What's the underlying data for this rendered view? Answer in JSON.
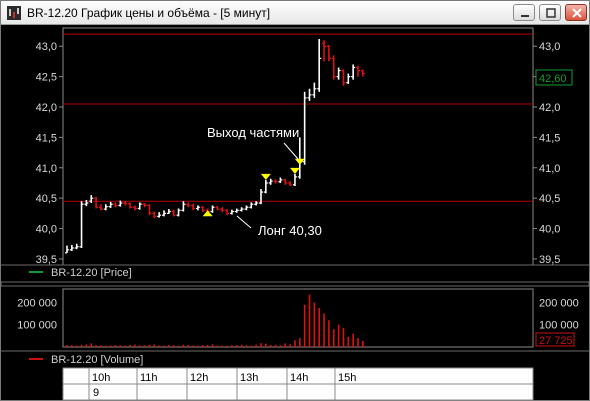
{
  "window": {
    "title": "BR-12.20 График цены и объёма - [5 минут]"
  },
  "price_panel": {
    "legend": "BR-12.20 [Price]",
    "legend_color": "#0f9d2d",
    "last_price_label": "42,60",
    "annotations": [
      {
        "text": "Выход частями"
      },
      {
        "text": "Лонг 40,30"
      }
    ],
    "yticks": [
      "43,0",
      "42,5",
      "42,0",
      "41,5",
      "41,0",
      "40,5",
      "40,0",
      "39,5"
    ]
  },
  "volume_panel": {
    "legend": "BR-12.20 [Volume]",
    "legend_color": "#cc1010",
    "last_volume_label": "27 725",
    "yticks": [
      "200 000",
      "100 000",
      "0"
    ]
  },
  "time_axis": {
    "hours": [
      "10h",
      "11h",
      "12h",
      "13h",
      "14h",
      "15h"
    ],
    "date": "9"
  },
  "colors": {
    "background": "#000000",
    "up_bar": "#ffffff",
    "down_bar": "#e01010",
    "level_line": "#b00000",
    "marker": "#ffff00"
  },
  "chart_data": [
    {
      "type": "line",
      "title": "BR-12.20 [Price]",
      "ylim": [
        39.4,
        43.3
      ],
      "horizontal_levels": [
        43.2,
        42.05,
        40.45
      ],
      "series": [
        {
          "name": "BR-12.20 [Price]",
          "close": [
            39.65,
            39.68,
            39.7,
            40.4,
            40.42,
            40.5,
            40.35,
            40.32,
            40.36,
            40.4,
            40.38,
            40.42,
            40.41,
            40.35,
            40.33,
            40.4,
            40.38,
            40.25,
            40.2,
            40.22,
            40.25,
            40.28,
            40.22,
            40.3,
            40.4,
            40.38,
            40.33,
            40.35,
            40.3,
            40.28,
            40.35,
            40.32,
            40.3,
            40.25,
            40.28,
            40.3,
            40.32,
            40.35,
            40.4,
            40.42,
            40.6,
            40.75,
            40.78,
            40.77,
            40.8,
            40.75,
            40.72,
            40.85,
            41.1,
            42.15,
            42.2,
            42.3,
            42.8,
            43.0,
            42.8,
            42.5,
            42.6,
            42.4,
            42.5,
            42.65,
            42.6,
            42.55
          ],
          "open": [
            39.6,
            39.65,
            39.68,
            39.7,
            40.4,
            40.45,
            40.5,
            40.35,
            40.32,
            40.36,
            40.4,
            40.38,
            40.42,
            40.41,
            40.35,
            40.33,
            40.4,
            40.38,
            40.25,
            40.2,
            40.22,
            40.25,
            40.28,
            40.22,
            40.3,
            40.4,
            40.38,
            40.33,
            40.35,
            40.3,
            40.28,
            40.35,
            40.32,
            40.3,
            40.25,
            40.28,
            40.3,
            40.32,
            40.35,
            40.4,
            40.42,
            40.6,
            40.75,
            40.78,
            40.77,
            40.8,
            40.75,
            40.72,
            40.85,
            41.1,
            42.15,
            42.2,
            42.3,
            43.05,
            43.0,
            42.8,
            42.5,
            42.6,
            42.4,
            42.5,
            42.65,
            42.6
          ],
          "high": [
            39.72,
            39.73,
            39.75,
            40.45,
            40.47,
            40.55,
            40.52,
            40.4,
            40.4,
            40.44,
            40.43,
            40.46,
            40.45,
            40.43,
            40.38,
            40.43,
            40.42,
            40.4,
            40.28,
            40.27,
            40.3,
            40.32,
            40.31,
            40.33,
            40.45,
            40.43,
            40.41,
            40.38,
            40.37,
            40.33,
            40.38,
            40.37,
            40.35,
            40.32,
            40.31,
            40.33,
            40.35,
            40.38,
            40.43,
            40.45,
            40.65,
            40.8,
            40.82,
            40.81,
            40.84,
            40.82,
            40.78,
            40.9,
            41.5,
            42.25,
            42.3,
            42.4,
            43.12,
            43.1,
            43.02,
            42.85,
            42.65,
            42.62,
            42.55,
            42.7,
            42.68,
            42.62
          ],
          "low": [
            39.6,
            39.63,
            39.66,
            39.68,
            40.37,
            40.42,
            40.33,
            40.3,
            40.3,
            40.34,
            40.35,
            40.36,
            40.38,
            40.33,
            40.3,
            40.31,
            40.35,
            40.22,
            40.17,
            40.18,
            40.2,
            40.24,
            40.2,
            40.2,
            40.28,
            40.35,
            40.3,
            40.3,
            40.27,
            40.26,
            40.26,
            40.3,
            40.27,
            40.22,
            40.23,
            40.26,
            40.28,
            40.3,
            40.33,
            40.38,
            40.4,
            40.58,
            40.72,
            40.74,
            40.75,
            40.72,
            40.7,
            40.7,
            40.82,
            41.05,
            42.1,
            42.15,
            42.25,
            42.75,
            42.75,
            42.45,
            42.45,
            42.35,
            42.38,
            42.45,
            42.5,
            42.5
          ]
        }
      ],
      "markers": [
        {
          "type": "buy",
          "x_index": 29,
          "y": 40.3
        },
        {
          "type": "sell",
          "x_index": 41,
          "y": 40.8
        },
        {
          "type": "sell",
          "x_index": 47,
          "y": 40.9
        },
        {
          "type": "sell",
          "x_index": 48,
          "y": 41.05
        }
      ]
    },
    {
      "type": "bar",
      "title": "BR-12.20 [Volume]",
      "ylim": [
        0,
        260000
      ],
      "series": [
        {
          "name": "BR-12.20 [Volume]",
          "values": [
            9000,
            8000,
            6000,
            10000,
            12000,
            16000,
            9000,
            8000,
            6000,
            7000,
            9000,
            8000,
            6000,
            9000,
            11000,
            7000,
            8000,
            10000,
            12000,
            7000,
            6000,
            9000,
            8000,
            5000,
            10000,
            9000,
            7000,
            6000,
            8000,
            9000,
            12000,
            7000,
            6000,
            5000,
            8000,
            9000,
            10000,
            7000,
            6000,
            11000,
            17000,
            15000,
            9000,
            10000,
            8000,
            16000,
            12000,
            30000,
            40000,
            190000,
            235000,
            200000,
            175000,
            150000,
            120000,
            80000,
            100000,
            85000,
            45000,
            60000,
            40000,
            27725
          ]
        }
      ]
    }
  ]
}
